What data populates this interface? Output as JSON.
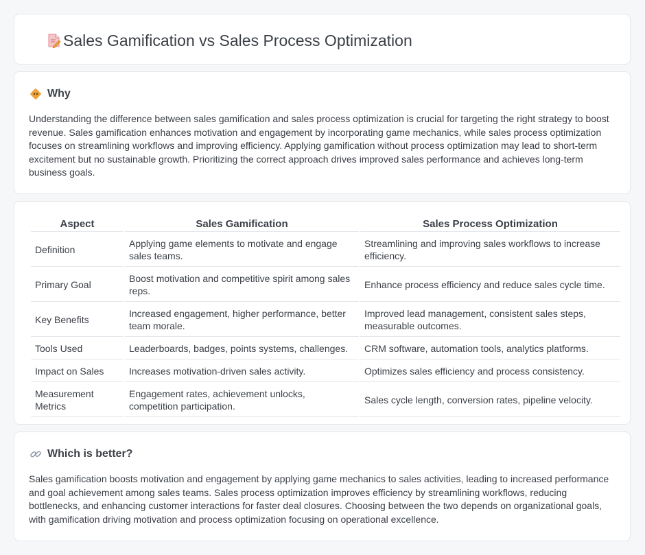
{
  "page": {
    "title": "Sales Gamification vs Sales Process Optimization",
    "title_icon": "document-edit-icon"
  },
  "why": {
    "heading": "Why",
    "icon": "diamond-warning-icon",
    "body": "Understanding the difference between sales gamification and sales process optimization is crucial for targeting the right strategy to boost revenue. Sales gamification enhances motivation and engagement by incorporating game mechanics, while sales process optimization focuses on streamlining workflows and improving efficiency. Applying gamification without process optimization may lead to short-term excitement but no sustainable growth. Prioritizing the correct approach drives improved sales performance and achieves long-term business goals."
  },
  "comparison": {
    "headers": [
      "Aspect",
      "Sales Gamification",
      "Sales Process Optimization"
    ],
    "rows": [
      {
        "aspect": "Definition",
        "gamification": "Applying game elements to motivate and engage sales teams.",
        "optimization": "Streamlining and improving sales workflows to increase efficiency."
      },
      {
        "aspect": "Primary Goal",
        "gamification": "Boost motivation and competitive spirit among sales reps.",
        "optimization": "Enhance process efficiency and reduce sales cycle time."
      },
      {
        "aspect": "Key Benefits",
        "gamification": "Increased engagement, higher performance, better team morale.",
        "optimization": "Improved lead management, consistent sales steps, measurable outcomes."
      },
      {
        "aspect": "Tools Used",
        "gamification": "Leaderboards, badges, points systems, challenges.",
        "optimization": "CRM software, automation tools, analytics platforms."
      },
      {
        "aspect": "Impact on Sales",
        "gamification": "Increases motivation-driven sales activity.",
        "optimization": "Optimizes sales efficiency and process consistency."
      },
      {
        "aspect": "Measurement Metrics",
        "gamification": "Engagement rates, achievement unlocks, competition participation.",
        "optimization": "Sales cycle length, conversion rates, pipeline velocity."
      }
    ]
  },
  "better": {
    "heading": "Which is better?",
    "icon": "link-icon",
    "body": "Sales gamification boosts motivation and engagement by applying game mechanics to sales activities, leading to increased performance and goal achievement among sales teams. Sales process optimization improves efficiency by streamlining workflows, reducing bottlenecks, and enhancing customer interactions for faster deal closures. Choosing between the two depends on organizational goals, with gamification driving motivation and process optimization focusing on operational excellence."
  },
  "colors": {
    "background": "#f6f7f9",
    "card": "#ffffff",
    "text": "#3a3f46",
    "border": "#e4e7eb",
    "accent_orange": "#f0a23a",
    "accent_pink": "#e7697a"
  }
}
